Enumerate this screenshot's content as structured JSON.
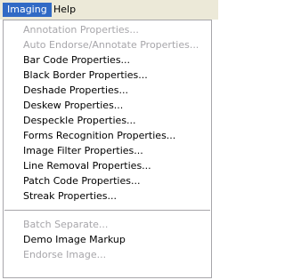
{
  "menubar": {
    "items": [
      {
        "label": "Imaging"
      },
      {
        "label": "Help"
      }
    ]
  },
  "imaging_menu": {
    "group1": [
      {
        "label": "Annotation Properties...",
        "enabled": false
      },
      {
        "label": "Auto Endorse/Annotate  Properties...",
        "enabled": false
      },
      {
        "label": "Bar Code Properties...",
        "enabled": true
      },
      {
        "label": "Black Border Properties...",
        "enabled": true
      },
      {
        "label": "Deshade Properties...",
        "enabled": true
      },
      {
        "label": "Deskew Properties...",
        "enabled": true
      },
      {
        "label": "Despeckle Properties...",
        "enabled": true
      },
      {
        "label": "Forms Recognition Properties...",
        "enabled": true
      },
      {
        "label": "Image Filter Properties...",
        "enabled": true
      },
      {
        "label": "Line Removal Properties...",
        "enabled": true
      },
      {
        "label": "Patch Code Properties...",
        "enabled": true
      },
      {
        "label": "Streak Properties...",
        "enabled": true
      }
    ],
    "group2": [
      {
        "label": "Batch Separate...",
        "enabled": false
      },
      {
        "label": "Demo Image Markup",
        "enabled": true
      },
      {
        "label": "Endorse Image...",
        "enabled": false
      }
    ]
  },
  "colors": {
    "menubar_bg": "#ece9d8",
    "highlight": "#316ac5",
    "disabled_text": "#a7a6aa",
    "menu_border": "#a7a6aa"
  }
}
